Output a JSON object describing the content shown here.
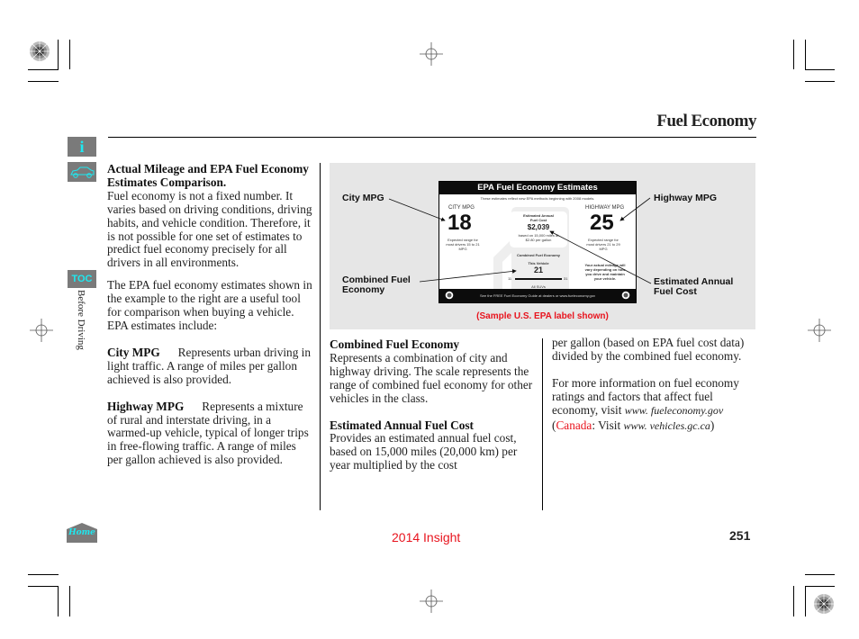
{
  "header": {
    "title": "Fuel Economy"
  },
  "side_nav": {
    "info_icon_label": "i",
    "toc_label": "TOC",
    "home_label": "Home",
    "section_label": "Before Driving"
  },
  "left_column": {
    "heading": "Actual Mileage and EPA Fuel Economy Estimates Comparison.",
    "intro": "Fuel economy is not a fixed number. It varies based on driving conditions, driving habits, and vehicle condition. Therefore, it is not possible for one set of estimates to predict fuel economy precisely for all drivers in all environments.",
    "para2": "The EPA fuel economy estimates shown in the example to the right are a useful tool for comparison when buying a vehicle. EPA estimates include:",
    "city_term": "City MPG",
    "city_desc": "Represents urban driving in light traffic. A range of miles per gallon achieved is also provided.",
    "highway_term": "Highway MPG",
    "highway_desc": "Represents a mixture of rural and interstate driving, in a warmed-up vehicle, typical of longer trips in free-flowing traffic. A range of miles per gallon achieved is also provided."
  },
  "figure": {
    "callouts": {
      "city": "City MPG",
      "highway": "Highway MPG",
      "combined": "Combined Fuel Economy",
      "annual": "Estimated Annual Fuel Cost"
    },
    "caption": "(Sample U.S. EPA label shown)",
    "epa_label": {
      "title": "EPA Fuel Economy Estimates",
      "subtitle": "These estimates reflect new EPA methods beginning with 2008 models.",
      "city_head": "CITY MPG",
      "city_value": "18",
      "city_range": "Expected range for most drivers 15 to 21 MPG",
      "highway_head": "HIGHWAY MPG",
      "highway_value": "25",
      "highway_range": "Expected range for most drivers 21 to 29 MPG",
      "cost_head": "Estimated Annual Fuel Cost",
      "cost_value": "$2,039",
      "cost_note": "based on 15,000 miles at $2.80 per gallon",
      "combined_head": "Combined Fuel Economy",
      "this_vehicle": "This Vehicle",
      "combined_value": "21",
      "scale_min": "11",
      "scale_max": "31",
      "all_suvs": "All SUVs",
      "mileage_note": "Your actual mileage will vary depending on how you drive and maintain your vehicle.",
      "footer": "See the FREE Fuel Economy Guide at dealers or www.fueleconomy.gov"
    }
  },
  "middle_column": {
    "combined_term": "Combined Fuel Economy",
    "combined_desc": "Represents a combination of city and highway driving. The scale represents the range of combined fuel economy for other vehicles in the class.",
    "annual_term": "Estimated Annual Fuel Cost",
    "annual_desc": "Provides an estimated annual fuel cost, based on 15,000 miles (20,000 km) per year multiplied by the cost"
  },
  "right_column": {
    "cont": "per gallon (based on EPA fuel cost data) divided by the combined fuel economy.",
    "more_info": "For more information on fuel economy ratings and factors that affect fuel economy, visit",
    "us_link": "www. fueleconomy.gov",
    "canada_open": "(",
    "canada_label": "Canada",
    "canada_visit": ": Visit",
    "canada_link": "www. vehicles.gc.ca",
    "canada_close": ")"
  },
  "footer": {
    "model": "2014 Insight",
    "page_number": "251"
  },
  "colors": {
    "accent_red": "#e8141e",
    "nav_button_bg": "#7a7a7a",
    "nav_button_fg": "#1ee8f0",
    "figure_bg": "#e6e6e6"
  }
}
